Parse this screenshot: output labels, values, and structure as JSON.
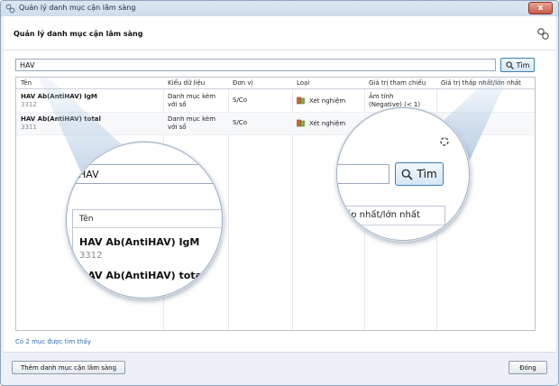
{
  "window": {
    "title": "Quản lý danh mục cận lâm sàng",
    "close_label": "x",
    "app_icon": "app-icon",
    "close_icon": "close-icon"
  },
  "header": {
    "title": "Quản lý danh mục cận lâm sàng",
    "settings_icon": "settings-icon"
  },
  "search": {
    "value": "HAV",
    "button_label": "Tìm",
    "button_icon": "search-icon"
  },
  "grid": {
    "columns": [
      "Tên",
      "Kiểu dữ liệu",
      "Đơn vị",
      "Loại",
      "Giá trị tham chiếu",
      "Giá trị thấp nhất/lớn nhất"
    ],
    "rows": [
      {
        "name": "HAV Ab(AntiHAV) IgM",
        "code": "3312",
        "data_type_line1": "Danh mục kèm",
        "data_type_line2": "với số",
        "unit": "S/Co",
        "category": "Xét nghiệm",
        "category_icon": "test-tube-icon",
        "reference_line1": "Âm tính",
        "reference_line2": "(Negative) (< 1)",
        "min_max": ""
      },
      {
        "name": "HAV Ab(AntiHAV) total",
        "code": "3311",
        "data_type_line1": "Danh mục kèm",
        "data_type_line2": "với số",
        "unit": "S/Co",
        "category": "Xét nghiệm",
        "category_icon": "test-tube-icon",
        "reference_line1": "",
        "reference_line2": "",
        "min_max": ""
      }
    ]
  },
  "zoom_left": {
    "search_value": "HAV",
    "header_label": "Tên",
    "row1_name": "HAV Ab(AntiHAV) IgM",
    "row1_code": "3312",
    "row2_name": "HAV Ab(AntiHAV) total"
  },
  "zoom_right": {
    "button_label": "Tìm",
    "header_fragment": "ấp nhất/lớn nhất"
  },
  "status": "Có 2 mục được tìm thấy",
  "footer": {
    "add_button": "Thêm danh mục cận lâm sàng",
    "close_button": "Đóng"
  },
  "colors": {
    "accent": "#3c7fb1",
    "status_link": "#2f6cb3",
    "close_button": "#c75a46"
  }
}
